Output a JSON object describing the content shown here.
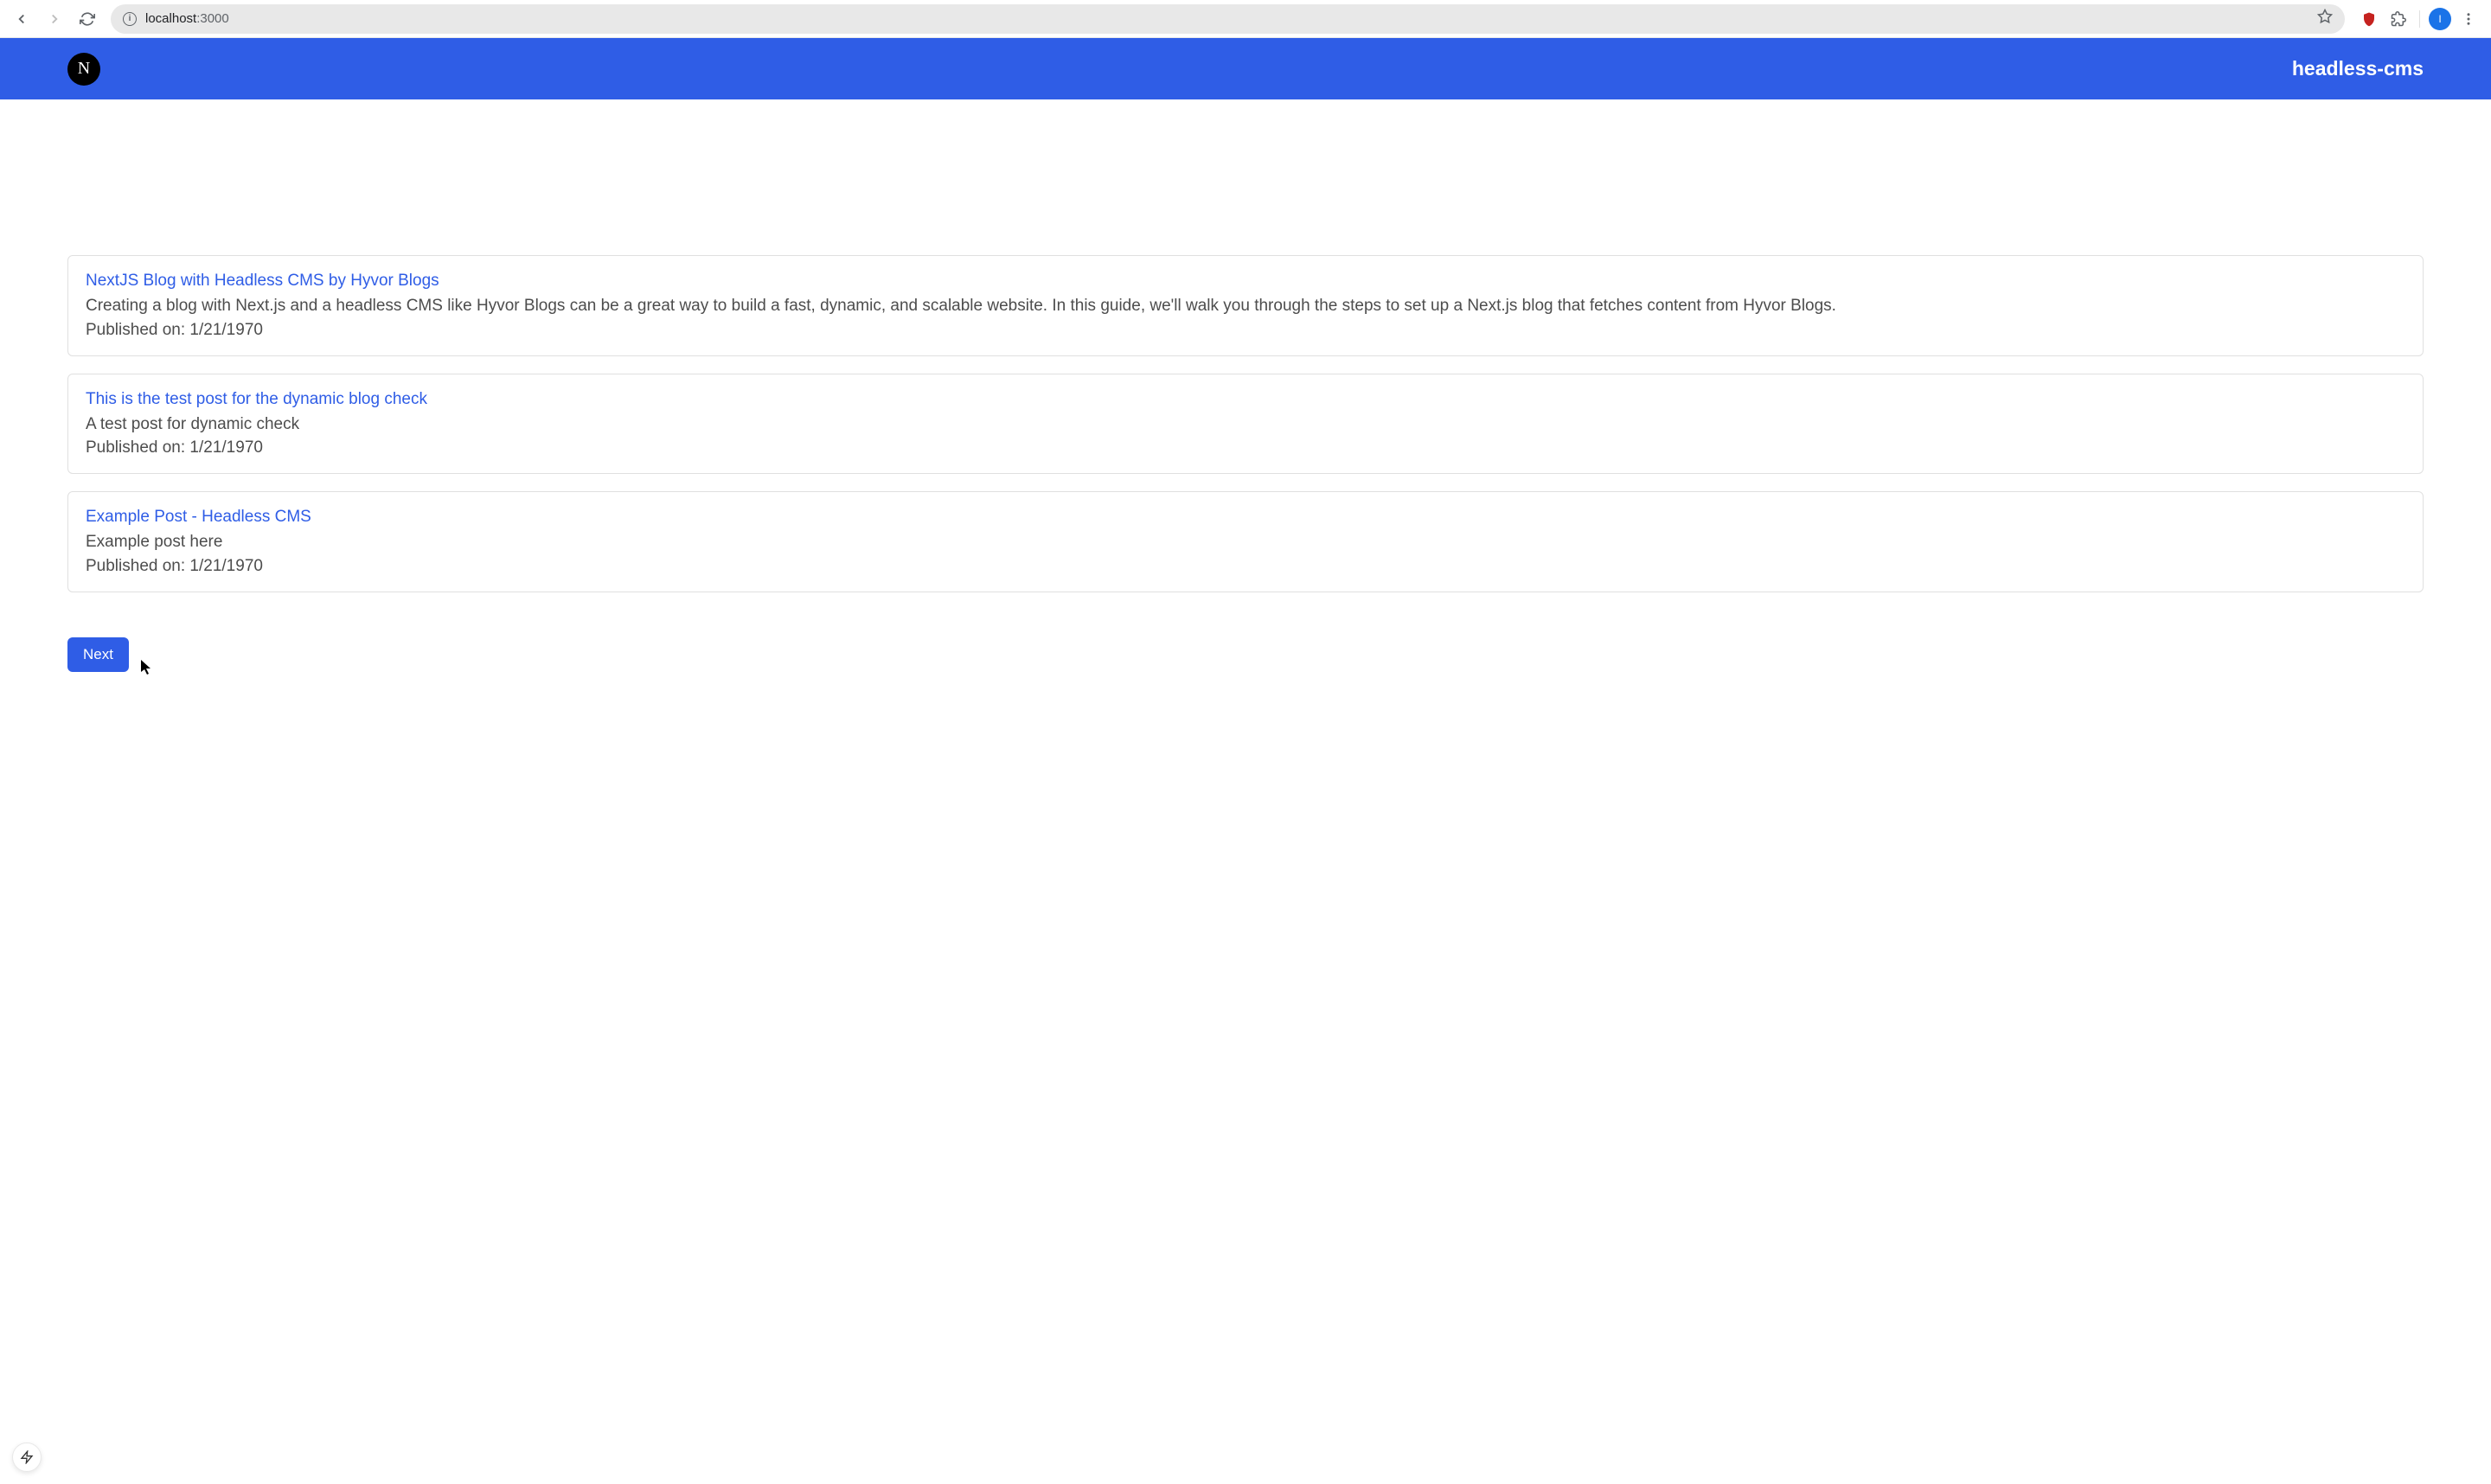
{
  "browser": {
    "url_host": "localhost",
    "url_port": ":3000",
    "avatar_initial": "I"
  },
  "header": {
    "title": "headless-cms",
    "logo_letter": "N"
  },
  "posts": [
    {
      "title": "NextJS Blog with Headless CMS by Hyvor Blogs",
      "description": "Creating a blog with Next.js and a headless CMS like Hyvor Blogs can be a great way to build a fast, dynamic, and scalable website. In this guide, we'll walk you through the steps to set up a Next.js blog that fetches content from Hyvor Blogs.",
      "published_label": "Published on: ",
      "published_date": "1/21/1970"
    },
    {
      "title": "This is the test post for the dynamic blog check",
      "description": "A test post for dynamic check",
      "published_label": "Published on: ",
      "published_date": "1/21/1970"
    },
    {
      "title": "Example Post - Headless CMS",
      "description": "Example post here",
      "published_label": "Published on: ",
      "published_date": "1/21/1970"
    }
  ],
  "pagination": {
    "next_label": "Next"
  }
}
